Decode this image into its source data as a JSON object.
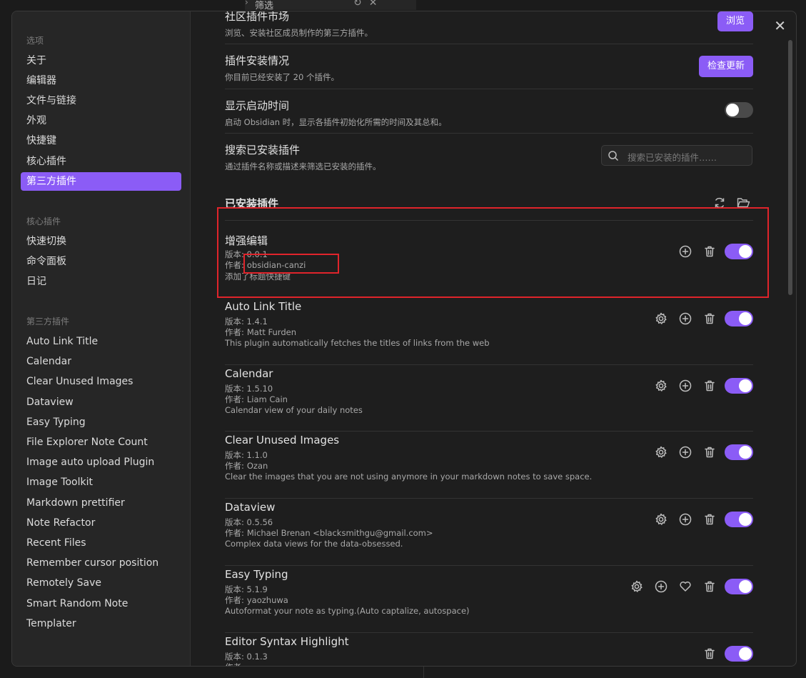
{
  "background_tab": {
    "label": "筛选"
  },
  "sidebar": {
    "groups": [
      "选项",
      "核心插件",
      "第三方插件"
    ],
    "options": [
      "关于",
      "编辑器",
      "文件与链接",
      "外观",
      "快捷键",
      "核心插件",
      "第三方插件"
    ],
    "core": [
      "快速切换",
      "命令面板",
      "日记"
    ],
    "third": [
      "Auto Link Title",
      "Calendar",
      "Clear Unused Images",
      "Dataview",
      "Easy Typing",
      "File Explorer Note Count",
      "Image auto upload Plugin",
      "Image Toolkit",
      "Markdown prettifier",
      "Note Refactor",
      "Recent Files",
      "Remember cursor position",
      "Remotely Save",
      "Smart Random Note",
      "Templater"
    ]
  },
  "settings": {
    "market": {
      "name": "社区插件市场",
      "desc": "浏览、安装社区成员制作的第三方插件。",
      "button": "浏览"
    },
    "installed": {
      "name": "插件安装情况",
      "desc": "你目前已经安装了 20 个插件。",
      "button": "检查更新"
    },
    "startup": {
      "name": "显示启动时间",
      "desc": "启动 Obsidian 时，显示各插件初始化所需的时间及其总和。",
      "enabled": false
    },
    "search": {
      "name": "搜索已安装插件",
      "desc": "通过插件名称或描述来筛选已安装的插件。",
      "placeholder": "搜索已安装的插件……"
    }
  },
  "installed_section": {
    "title": "已安装插件"
  },
  "plugins": [
    {
      "name": "增强编辑",
      "version": "版本: 0.0.1",
      "author_label": "作者:",
      "author": "obsidian-canzi",
      "desc": "添加了标题快捷键",
      "icons": [
        "plus-circle-icon",
        "trash-icon"
      ],
      "enabled": true
    },
    {
      "name": "Auto Link Title",
      "version": "版本: 1.4.1",
      "author_label": "作者:",
      "author": "Matt Furden",
      "desc": "This plugin automatically fetches the titles of links from the web",
      "icons": [
        "gear-icon",
        "plus-circle-icon",
        "trash-icon"
      ],
      "enabled": true
    },
    {
      "name": "Calendar",
      "version": "版本: 1.5.10",
      "author_label": "作者:",
      "author": "Liam Cain",
      "desc": "Calendar view of your daily notes",
      "icons": [
        "gear-icon",
        "plus-circle-icon",
        "trash-icon"
      ],
      "enabled": true
    },
    {
      "name": "Clear Unused Images",
      "version": "版本: 1.1.0",
      "author_label": "作者:",
      "author": "Ozan",
      "desc": "Clear the images that you are not using anymore in your markdown notes to save space.",
      "icons": [
        "gear-icon",
        "plus-circle-icon",
        "trash-icon"
      ],
      "enabled": true
    },
    {
      "name": "Dataview",
      "version": "版本: 0.5.56",
      "author_label": "作者:",
      "author": "Michael Brenan <blacksmithgu@gmail.com>",
      "desc": "Complex data views for the data-obsessed.",
      "icons": [
        "gear-icon",
        "plus-circle-icon",
        "trash-icon"
      ],
      "enabled": true
    },
    {
      "name": "Easy Typing",
      "version": "版本: 5.1.9",
      "author_label": "作者:",
      "author": "yaozhuwa",
      "desc": "Autoformat your note as typing.(Auto captalize, autospace)",
      "icons": [
        "gear-icon",
        "plus-circle-icon",
        "heart-icon",
        "trash-icon"
      ],
      "enabled": true
    },
    {
      "name": "Editor Syntax Highlight",
      "version": "版本: 0.1.3",
      "author_label": "作者:",
      "author": "",
      "desc": "",
      "icons": [
        "trash-icon"
      ],
      "enabled": true
    }
  ],
  "colors": {
    "accent": "#8b5cf6",
    "highlight": "#e0242b",
    "background": "#1e1e1e",
    "sidebar": "#262626"
  }
}
